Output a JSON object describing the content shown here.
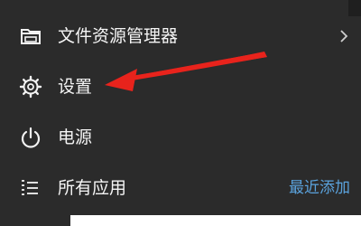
{
  "colors": {
    "background": "#2b2b2b",
    "text": "#f5f5f5",
    "link": "#5aa2dc",
    "annotation_arrow": "#e8231c"
  },
  "menu": {
    "items": [
      {
        "label": "文件资源管理器",
        "icon": "folder-explorer-icon",
        "has_submenu": true
      },
      {
        "label": "设置",
        "icon": "gear-icon"
      },
      {
        "label": "电源",
        "icon": "power-icon"
      },
      {
        "label": "所有应用",
        "icon": "list-icon",
        "link": "最近添加"
      }
    ]
  }
}
